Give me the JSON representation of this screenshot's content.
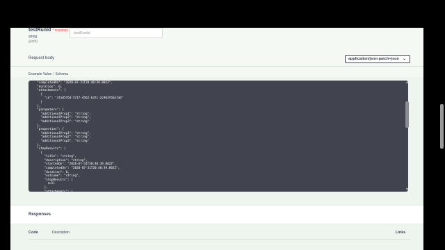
{
  "param": {
    "name": "testRunId",
    "required": "* required",
    "type": "string",
    "in": "(path)",
    "placeholder": "testRunId"
  },
  "request_body": {
    "label": "Request body",
    "content_type": "application/json-patch+json",
    "tab_example": "Example Value",
    "tab_schema": "Schema",
    "code": "  \"completedOn\": \"2020-07-31T20:40:39.802Z\",\n  \"duration\": 0,\n  \"attachments\": [\n    {\n      \"id\": \"3fa85f64-5717-4562-b3fc-2c963f66afa6\"\n    }\n  ],\n  \"parameters\": {\n    \"additionalProp1\": \"string\",\n    \"additionalProp2\": \"string\",\n    \"additionalProp3\": \"string\"\n  },\n  \"properties\": {\n    \"additionalProp1\": \"string\",\n    \"additionalProp2\": \"string\",\n    \"additionalProp3\": \"string\"\n  },\n  \"stepResults\": [\n    {\n      \"title\": \"string\",\n      \"description\": \"string\",\n      \"startedOn\": \"2020-07-31T20:40:39.802Z\",\n      \"completedOn\": \"2020-07-31T20:40:39.802Z\",\n      \"duration\": 0,\n      \"outcome\": \"string\",\n      \"stepResults\": [\n        null\n      ],\n      \"attachments\": ["
  },
  "responses": {
    "title": "Responses",
    "col_code": "Code",
    "col_description": "Description",
    "col_links": "Links"
  }
}
